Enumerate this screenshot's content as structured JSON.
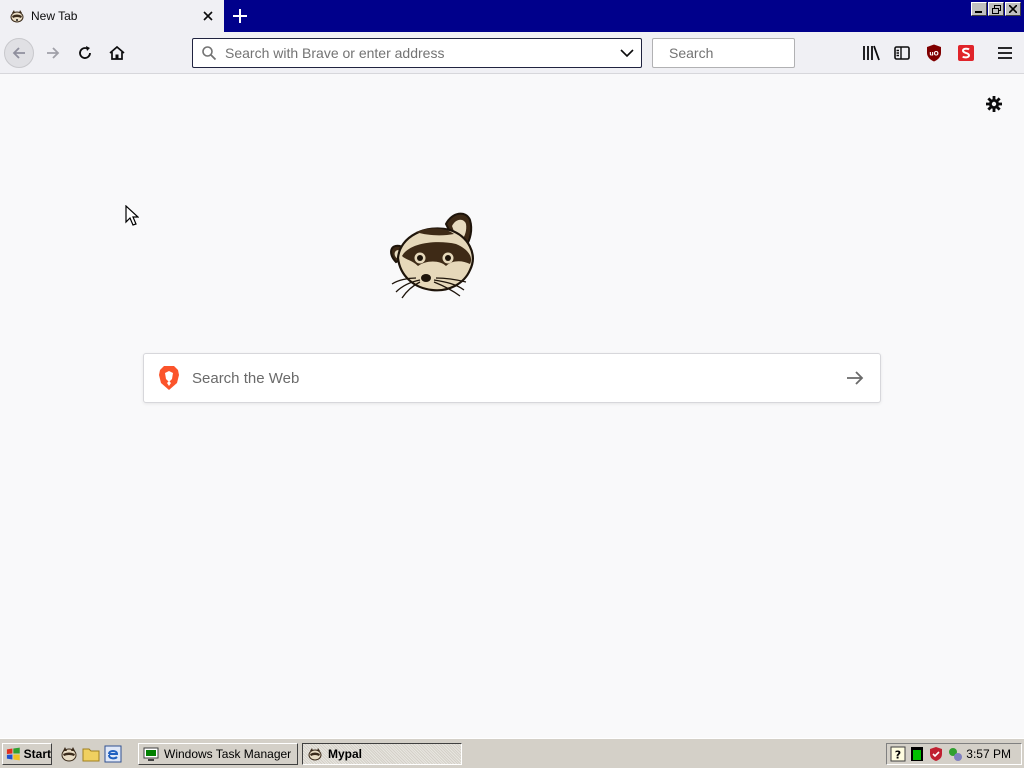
{
  "tab": {
    "title": "New Tab"
  },
  "urlbar": {
    "placeholder": "Search with Brave or enter address"
  },
  "searchbar": {
    "placeholder": "Search"
  },
  "page": {
    "websearch_placeholder": "Search the Web"
  },
  "taskbar": {
    "start_label": "Start",
    "tasks": [
      {
        "label": "Windows Task Manager"
      },
      {
        "label": "Mypal"
      }
    ],
    "clock": "3:57 PM"
  },
  "colors": {
    "titlebar": "#00008b",
    "toolbar": "#f0f0f4",
    "page": "#f9f9fa",
    "taskbar": "#d4d0c8",
    "brave_red": "#fb542b"
  },
  "icons": [
    "raccoon-icon",
    "close-icon",
    "plus-icon",
    "back-icon",
    "forward-icon",
    "reload-icon",
    "home-icon",
    "search-icon",
    "chevron-down-icon",
    "library-icon",
    "sidebar-icon",
    "ublock-icon",
    "extension-s-icon",
    "menu-icon",
    "gear-icon",
    "brave-lion-icon",
    "arrow-right-icon"
  ]
}
